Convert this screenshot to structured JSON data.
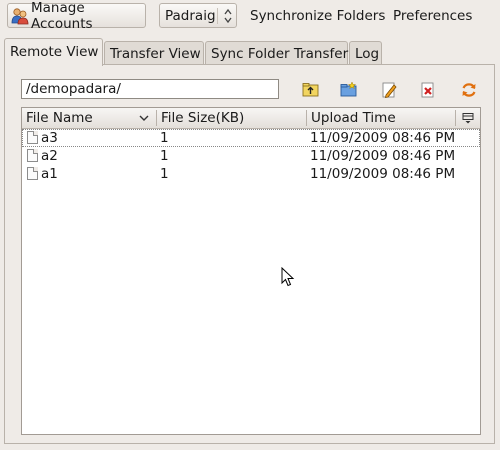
{
  "toolbar": {
    "manage_accounts_label": "Manage Accounts",
    "account_selected": "Padraig",
    "sync_folders_label": "Synchronize Folders",
    "preferences_label": "Preferences"
  },
  "tabs": [
    {
      "label": "Remote View",
      "active": true
    },
    {
      "label": "Transfer View",
      "active": false
    },
    {
      "label": "Sync Folder Transfer",
      "active": false
    },
    {
      "label": "Log",
      "active": false
    }
  ],
  "remote_view": {
    "path": "/demopadara/",
    "icons": [
      "folder-up-icon",
      "new-folder-icon",
      "rename-icon",
      "delete-icon",
      "refresh-icon"
    ],
    "columns": [
      "File Name",
      "File Size(KB)",
      "Upload Time"
    ],
    "files": [
      {
        "name": "a3",
        "size": "1",
        "time": "11/09/2009 08:46 PM"
      },
      {
        "name": "a2",
        "size": "1",
        "time": "11/09/2009 08:46 PM"
      },
      {
        "name": "a1",
        "size": "1",
        "time": "11/09/2009 08:46 PM"
      }
    ]
  }
}
